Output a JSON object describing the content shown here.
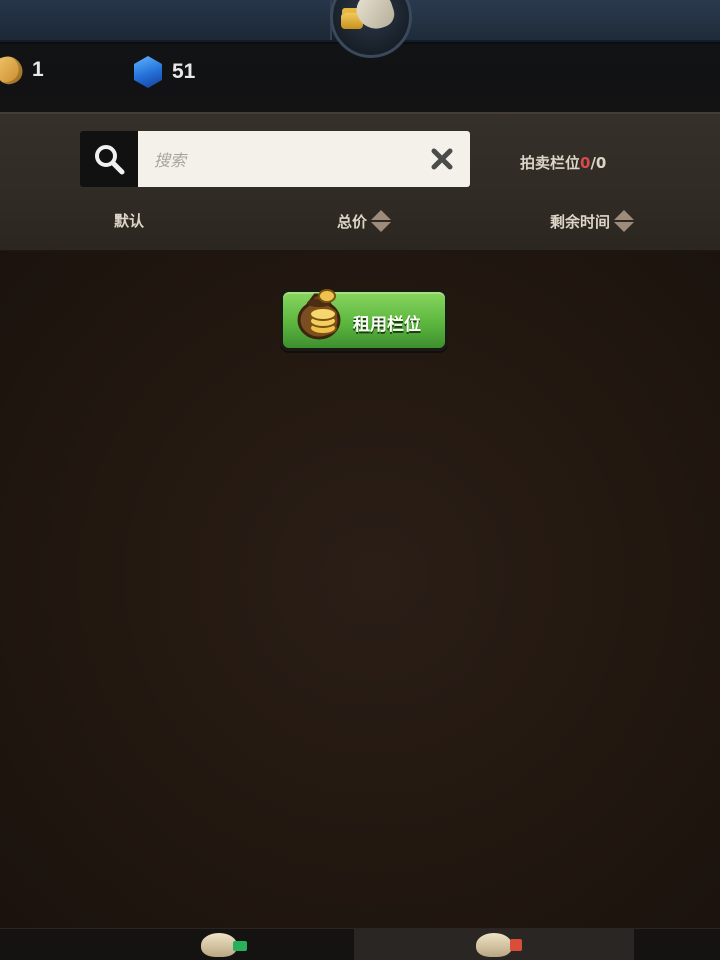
{
  "header": {
    "currencies": {
      "hand_count": "1",
      "gem_count": "51"
    }
  },
  "search": {
    "placeholder": "搜索",
    "auction_slots_label": "拍卖栏位",
    "auction_slots_used": "0",
    "auction_slots_total": "/0"
  },
  "sort": {
    "default": "默认",
    "total_price": "总价",
    "remaining_time": "剩余时间"
  },
  "main": {
    "rent_slot_button": "租用栏位"
  },
  "colors": {
    "accent_green": "#5cb73f",
    "counter_red": "#d84a4a",
    "gem_blue": "#2470d8"
  },
  "icons": {
    "search": "search-icon",
    "clear": "close-icon",
    "money_bag": "money-bag-icon",
    "gem": "gem-icon",
    "hand": "hand-icon"
  }
}
